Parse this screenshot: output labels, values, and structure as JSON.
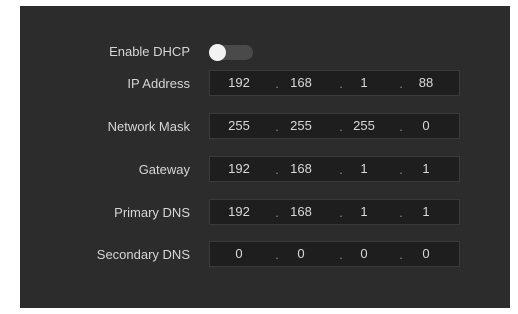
{
  "dhcp": {
    "label": "Enable DHCP",
    "enabled": false
  },
  "fields": [
    {
      "label": "IP Address",
      "octets": [
        "192",
        "168",
        "1",
        "88"
      ]
    },
    {
      "label": "Network Mask",
      "octets": [
        "255",
        "255",
        "255",
        "0"
      ]
    },
    {
      "label": "Gateway",
      "octets": [
        "192",
        "168",
        "1",
        "1"
      ]
    },
    {
      "label": "Primary DNS",
      "octets": [
        "192",
        "168",
        "1",
        "1"
      ]
    },
    {
      "label": "Secondary DNS",
      "octets": [
        "0",
        "0",
        "0",
        "0"
      ]
    }
  ],
  "separator": "."
}
